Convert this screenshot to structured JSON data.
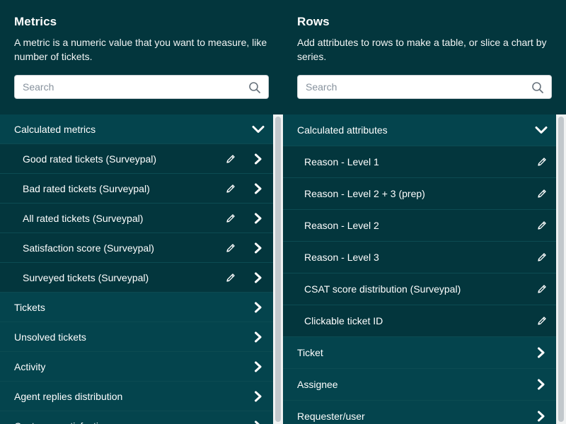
{
  "metrics": {
    "title": "Metrics",
    "description": "A metric is a numeric value that you want to measure, like number of tickets.",
    "search_placeholder": "Search",
    "items": [
      {
        "label": "Calculated metrics",
        "type": "category",
        "state": "expanded"
      },
      {
        "label": "Good rated tickets (Surveypal)",
        "type": "item",
        "editable": true
      },
      {
        "label": "Bad rated tickets (Surveypal)",
        "type": "item",
        "editable": true
      },
      {
        "label": "All rated tickets (Surveypal)",
        "type": "item",
        "editable": true
      },
      {
        "label": "Satisfaction score (Surveypal)",
        "type": "item",
        "editable": true
      },
      {
        "label": "Surveyed tickets (Surveypal)",
        "type": "item",
        "editable": true
      },
      {
        "label": "Tickets",
        "type": "category",
        "state": "collapsed"
      },
      {
        "label": "Unsolved tickets",
        "type": "category",
        "state": "collapsed"
      },
      {
        "label": "Activity",
        "type": "category",
        "state": "collapsed"
      },
      {
        "label": "Agent replies distribution",
        "type": "category",
        "state": "collapsed"
      },
      {
        "label": "Customer satisfaction",
        "type": "category",
        "state": "collapsed"
      }
    ]
  },
  "rows": {
    "title": "Rows",
    "description": "Add attributes to rows to make a table, or slice a chart by series.",
    "search_placeholder": "Search",
    "items": [
      {
        "label": "Calculated attributes",
        "type": "category",
        "state": "expanded"
      },
      {
        "label": "Reason - Level 1",
        "type": "item",
        "editable": true
      },
      {
        "label": "Reason - Level 2 + 3 (prep)",
        "type": "item",
        "editable": true
      },
      {
        "label": "Reason - Level 2",
        "type": "item",
        "editable": true
      },
      {
        "label": "Reason - Level 3",
        "type": "item",
        "editable": true
      },
      {
        "label": "CSAT score distribution (Surveypal)",
        "type": "item",
        "editable": true
      },
      {
        "label": "Clickable ticket ID",
        "type": "item",
        "editable": true
      },
      {
        "label": "Ticket",
        "type": "category",
        "state": "collapsed"
      },
      {
        "label": "Assignee",
        "type": "category",
        "state": "collapsed"
      },
      {
        "label": "Requester/user",
        "type": "category",
        "state": "collapsed"
      }
    ]
  },
  "colors": {
    "background": "#03363d",
    "category_row": "#04444d",
    "divider": "#0c4b52",
    "text": "#ffffff",
    "scrollbar_track": "#f0f2f2",
    "scrollbar_thumb": "#c2c8cc"
  }
}
